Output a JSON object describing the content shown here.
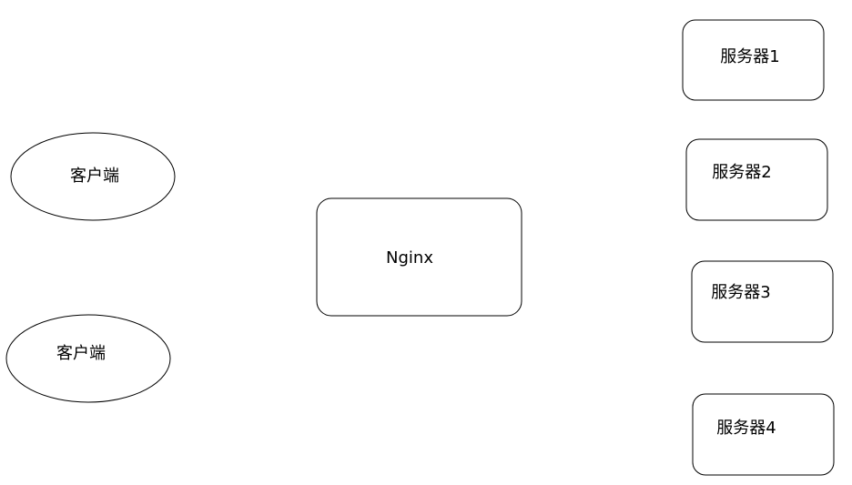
{
  "diagram": {
    "clients": [
      {
        "label": "客户端"
      },
      {
        "label": "客户端"
      }
    ],
    "proxy": {
      "label": "Nginx"
    },
    "servers": [
      {
        "label": "服务器1"
      },
      {
        "label": "服务器2"
      },
      {
        "label": "服务器3"
      },
      {
        "label": "服务器4"
      }
    ],
    "colors": {
      "stroke": "#000000",
      "fill": "#ffffff",
      "text": "#000000"
    }
  }
}
